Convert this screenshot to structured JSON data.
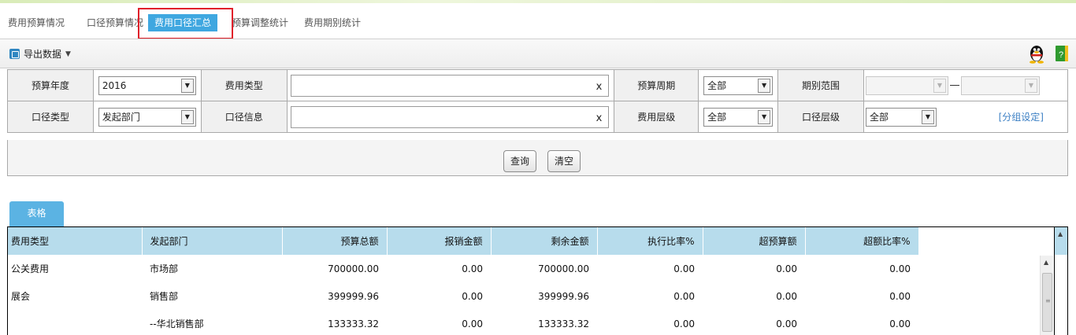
{
  "tabs": [
    {
      "label": "费用预算情况",
      "active": false
    },
    {
      "label": "口径预算情况",
      "active": false
    },
    {
      "label": "费用口径汇总",
      "active": true
    },
    {
      "label": "预算调整统计",
      "active": false
    },
    {
      "label": "费用期别统计",
      "active": false
    }
  ],
  "toolbar": {
    "export_label": "导出数据",
    "export_caret": "▼"
  },
  "filters": {
    "budget_year": {
      "label": "预算年度",
      "value": "2016"
    },
    "expense_type": {
      "label": "费用类型",
      "value": "",
      "clear": "x"
    },
    "budget_period": {
      "label": "预算周期",
      "value": "全部"
    },
    "period_range": {
      "label": "期别范围",
      "from": "",
      "to": ""
    },
    "scope_type": {
      "label": "口径类型",
      "value": "发起部门"
    },
    "scope_info": {
      "label": "口径信息",
      "value": "",
      "clear": "x"
    },
    "expense_level": {
      "label": "费用层级",
      "value": "全部"
    },
    "scope_level": {
      "label": "口径层级",
      "value": "全部"
    },
    "group_setting": "[分组设定]"
  },
  "buttons": {
    "query": "查询",
    "clear": "清空"
  },
  "sheet_tab": "表格",
  "table": {
    "columns": [
      "费用类型",
      "发起部门",
      "预算总额",
      "报销金额",
      "剩余金额",
      "执行比率%",
      "超预算额",
      "超额比率%"
    ],
    "rows": [
      [
        "公关费用",
        "市场部",
        "700000.00",
        "0.00",
        "700000.00",
        "0.00",
        "0.00",
        "0.00"
      ],
      [
        "展会",
        "销售部",
        "399999.96",
        "0.00",
        "399999.96",
        "0.00",
        "0.00",
        "0.00"
      ],
      [
        "",
        "--华北销售部",
        "133333.32",
        "0.00",
        "133333.32",
        "0.00",
        "0.00",
        "0.00"
      ]
    ]
  },
  "colors": {
    "accent": "#3fa7e0",
    "header_bg": "#b7dcec",
    "highlight": "#e0202a"
  }
}
